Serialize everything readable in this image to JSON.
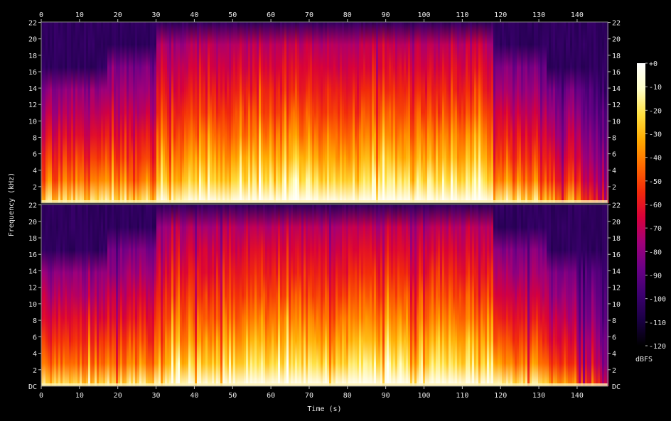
{
  "chart_data": {
    "type": "heatmap",
    "subtype": "spectrogram",
    "channels": 2,
    "xlabel": "Time (s)",
    "ylabel": "Frequency (kHz)",
    "x_ticks": [
      0,
      10,
      20,
      30,
      40,
      50,
      60,
      70,
      80,
      90,
      100,
      110,
      120,
      130,
      140
    ],
    "xlim": [
      0,
      148
    ],
    "y_ticks": [
      2,
      4,
      6,
      8,
      10,
      12,
      14,
      16,
      18,
      20,
      22
    ],
    "y_bottom_label": "DC",
    "ylim_khz": [
      0,
      22.05
    ],
    "colorbar": {
      "label": "dBFS",
      "ticks": [
        "+0",
        "-10",
        "-20",
        "-30",
        "-40",
        "-50",
        "-60",
        "-70",
        "-80",
        "-90",
        "-100",
        "-110",
        "-120"
      ],
      "range": [
        -120,
        0
      ],
      "colors": [
        "#000000",
        "#1a0044",
        "#3d0070",
        "#6a0086",
        "#a0007a",
        "#d8003a",
        "#f22a0a",
        "#ff6a00",
        "#ffaa00",
        "#ffe040",
        "#ffffc8",
        "#ffffff"
      ]
    },
    "segments": [
      {
        "t0": 0,
        "t1": 17,
        "level": 0.8,
        "cutoff_khz": 16.0
      },
      {
        "t0": 17,
        "t1": 30,
        "level": 0.82,
        "cutoff_khz": 17.0
      },
      {
        "t0": 30,
        "t1": 37,
        "level": 0.92,
        "cutoff_khz": 22.0
      },
      {
        "t0": 37,
        "t1": 53,
        "level": 0.95,
        "cutoff_khz": 22.0
      },
      {
        "t0": 53,
        "t1": 118,
        "level": 1.0,
        "cutoff_khz": 22.0
      },
      {
        "t0": 118,
        "t1": 132,
        "level": 0.82,
        "cutoff_khz": 17.0
      },
      {
        "t0": 132,
        "t1": 148,
        "level": 0.7,
        "cutoff_khz": 16.0
      }
    ]
  }
}
